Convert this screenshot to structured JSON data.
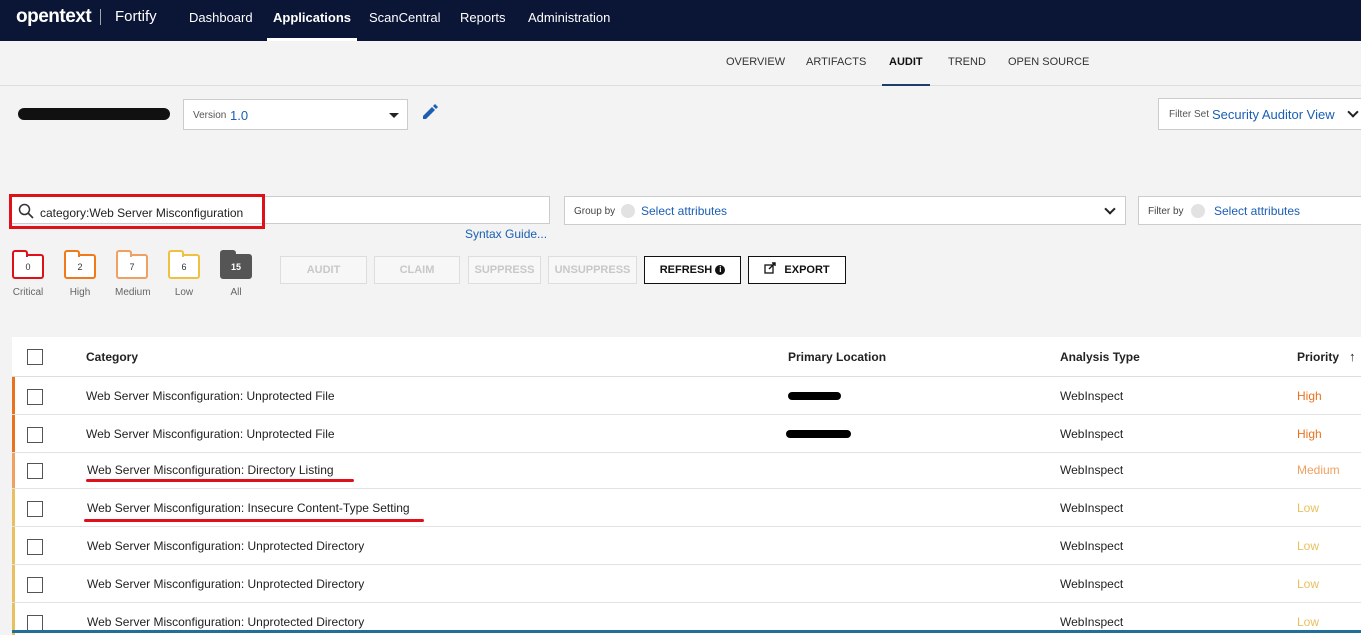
{
  "nav": {
    "brand": "opentext",
    "product": "Fortify",
    "items": [
      "Dashboard",
      "Applications",
      "ScanCentral",
      "Reports",
      "Administration"
    ],
    "active": "Applications"
  },
  "subtabs": [
    "OVERVIEW",
    "ARTIFACTS",
    "AUDIT",
    "TREND",
    "OPEN SOURCE"
  ],
  "version": {
    "label": "Version",
    "value": "1.0"
  },
  "filter_set": {
    "label": "Filter Set",
    "value": "Security Auditor View"
  },
  "search": {
    "value": "category:Web Server Misconfiguration",
    "syntax_link": "Syntax Guide..."
  },
  "group_by": {
    "label": "Group by",
    "value": "Select attributes"
  },
  "filter_by": {
    "label": "Filter by",
    "value": "Select attributes"
  },
  "severity": [
    {
      "label": "Critical",
      "count": "0",
      "color": "#e0101b"
    },
    {
      "label": "High",
      "count": "2",
      "color": "#f07a1a"
    },
    {
      "label": "Medium",
      "count": "7",
      "color": "#f0a060"
    },
    {
      "label": "Low",
      "count": "6",
      "color": "#f0c040"
    },
    {
      "label": "All",
      "count": "15",
      "color": "#555555"
    }
  ],
  "buttons": {
    "audit": "AUDIT",
    "claim": "CLAIM",
    "suppress": "SUPPRESS",
    "unsuppress": "UNSUPPRESS",
    "refresh": "REFRESH",
    "export": "EXPORT"
  },
  "table": {
    "headers": {
      "category": "Category",
      "location": "Primary Location",
      "analysis": "Analysis Type",
      "priority": "Priority"
    },
    "rows": [
      {
        "category": "Web Server Misconfiguration: Unprotected File",
        "analysis": "WebInspect",
        "priority": "High",
        "color": "#e8731f"
      },
      {
        "category": "Web Server Misconfiguration: Unprotected File",
        "analysis": "WebInspect",
        "priority": "High",
        "color": "#e8731f"
      },
      {
        "category": "Web Server Misconfiguration: Directory Listing",
        "analysis": "WebInspect",
        "priority": "Medium",
        "color": "#f0a060"
      },
      {
        "category": "Web Server Misconfiguration: Insecure Content-Type Setting",
        "analysis": "WebInspect",
        "priority": "Low",
        "color": "#e8c060"
      },
      {
        "category": "Web Server Misconfiguration: Unprotected Directory",
        "analysis": "WebInspect",
        "priority": "Low",
        "color": "#e8c060"
      },
      {
        "category": "Web Server Misconfiguration: Unprotected Directory",
        "analysis": "WebInspect",
        "priority": "Low",
        "color": "#e8c060"
      },
      {
        "category": "Web Server Misconfiguration: Unprotected Directory",
        "analysis": "WebInspect",
        "priority": "Low",
        "color": "#e8c060"
      }
    ]
  }
}
